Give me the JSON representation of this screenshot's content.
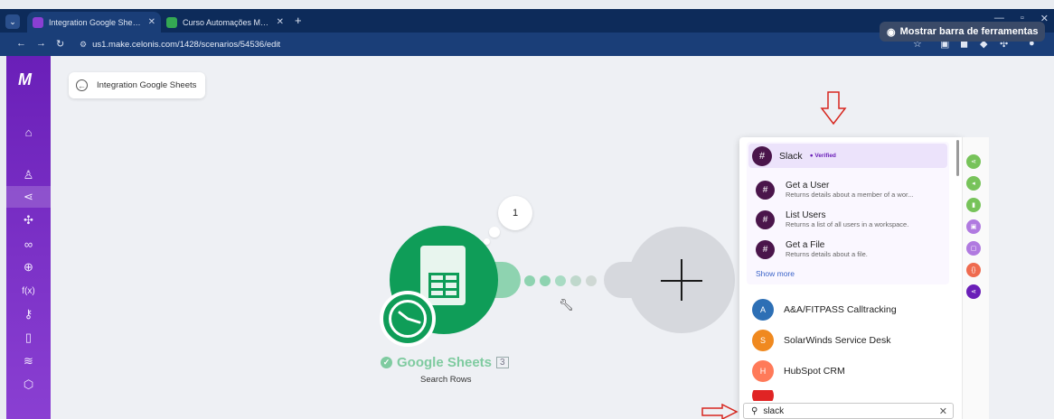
{
  "browser": {
    "tabs": [
      {
        "label": "Integration Google Sheets | Ma",
        "active": true,
        "icon_color": "#8a3fd2"
      },
      {
        "label": "Curso Automações Make - CST",
        "active": false,
        "icon_color": "#34a853"
      }
    ],
    "url": "us1.make.celonis.com/1428/scenarios/54536/edit",
    "tooltip": "Mostrar barra de ferramentas"
  },
  "sidebar": {
    "logo": "M",
    "items": [
      {
        "icon": "home-icon",
        "glyph": "⌂"
      },
      {
        "icon": "team-icon",
        "glyph": "♙"
      },
      {
        "icon": "scenarios-icon",
        "glyph": "⋖"
      },
      {
        "icon": "apps-icon",
        "glyph": "✣"
      },
      {
        "icon": "connections-icon",
        "glyph": "∞"
      },
      {
        "icon": "webhooks-icon",
        "glyph": "⊕"
      },
      {
        "icon": "functions-icon",
        "glyph": "f(x)"
      },
      {
        "icon": "keys-icon",
        "glyph": "⚷"
      },
      {
        "icon": "devices-icon",
        "glyph": "▯"
      },
      {
        "icon": "datastores-icon",
        "glyph": "≋"
      },
      {
        "icon": "datastructures-icon",
        "glyph": "⬡"
      }
    ]
  },
  "breadcrumb": {
    "label": "Integration Google Sheets"
  },
  "module": {
    "bubble_count": "1",
    "name": "Google Sheets",
    "count": "3",
    "action": "Search Rows"
  },
  "search_panel": {
    "slack": {
      "name": "Slack",
      "verified": "Verified",
      "actions": [
        {
          "title": "Get a User",
          "desc": "Returns details about a member of a wor..."
        },
        {
          "title": "List Users",
          "desc": "Returns a list of all users in a workspace."
        },
        {
          "title": "Get a File",
          "desc": "Returns details about a file."
        }
      ],
      "show_more": "Show more"
    },
    "apps": [
      {
        "name": "A&A/FITPASS Calltracking",
        "color": "#2d6fb5",
        "glyph": "A"
      },
      {
        "name": "SolarWinds Service Desk",
        "color": "#f0891f",
        "glyph": "S"
      },
      {
        "name": "HubSpot CRM",
        "color": "#ff7a59",
        "glyph": "H"
      }
    ],
    "search": {
      "value": "slack"
    }
  },
  "rail_colors": [
    "#77c35a",
    "#77c35a",
    "#77c35a",
    "#b07ae0",
    "#b07ae0",
    "#ef6b4f",
    "#6a1fb8"
  ]
}
